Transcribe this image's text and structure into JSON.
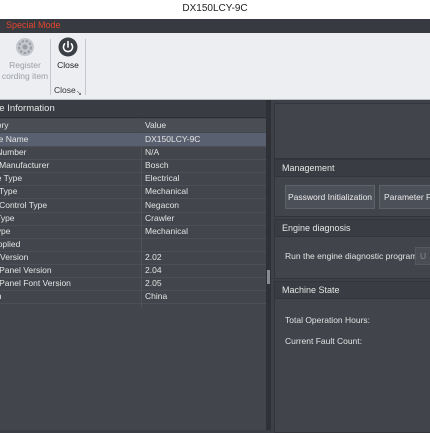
{
  "window": {
    "title": "DX150LCY-9C"
  },
  "mode": {
    "label": "Special Mode"
  },
  "ribbon": {
    "register_label_line1": "Register",
    "register_label_line2": "cording item",
    "close_label": "Close",
    "group_label": "Close"
  },
  "engine_info": {
    "title": "ne Information",
    "columns": {
      "key": "gory",
      "value": "Value"
    },
    "rows": [
      {
        "key": "ine Name",
        "value": "DX150LCY-9C"
      },
      {
        "key": "l Number",
        "value": "N/A"
      },
      {
        "key": "e Manufacturer",
        "value": "Bosch"
      },
      {
        "key": "ne Type",
        "value": "Electrical"
      },
      {
        "key": "p Type",
        "value": "Mechanical"
      },
      {
        "key": "p Control Type",
        "value": "Negacon"
      },
      {
        "key": "l Type",
        "value": "Crawler"
      },
      {
        "key": " Type",
        "value": "Mechanical"
      },
      {
        "key": "Applied",
        "value": ""
      },
      {
        "key": "S Version",
        "value": "2.02"
      },
      {
        "key": "e Panel Version",
        "value": "2.04"
      },
      {
        "key": "e Panel Font Version",
        "value": "2.05"
      },
      {
        "key": "on",
        "value": "China"
      }
    ]
  },
  "management": {
    "title": "Management",
    "password_init_label": "Password Initialization",
    "parameter_label": "Parameter Fa"
  },
  "engine_diagnosis": {
    "title": "Engine diagnosis",
    "run_label": "Run the engine diagnostic program:",
    "button_label": "U"
  },
  "machine_state": {
    "title": "Machine State",
    "hours_label": "Total Operation Hours:",
    "fault_label": "Current Fault Count:"
  },
  "colors": {
    "mode_text": "#e3462b",
    "selected_row": "#596170",
    "panel_bg": "#42454c"
  },
  "icons": [
    "settings-gear-icon",
    "power-icon"
  ]
}
